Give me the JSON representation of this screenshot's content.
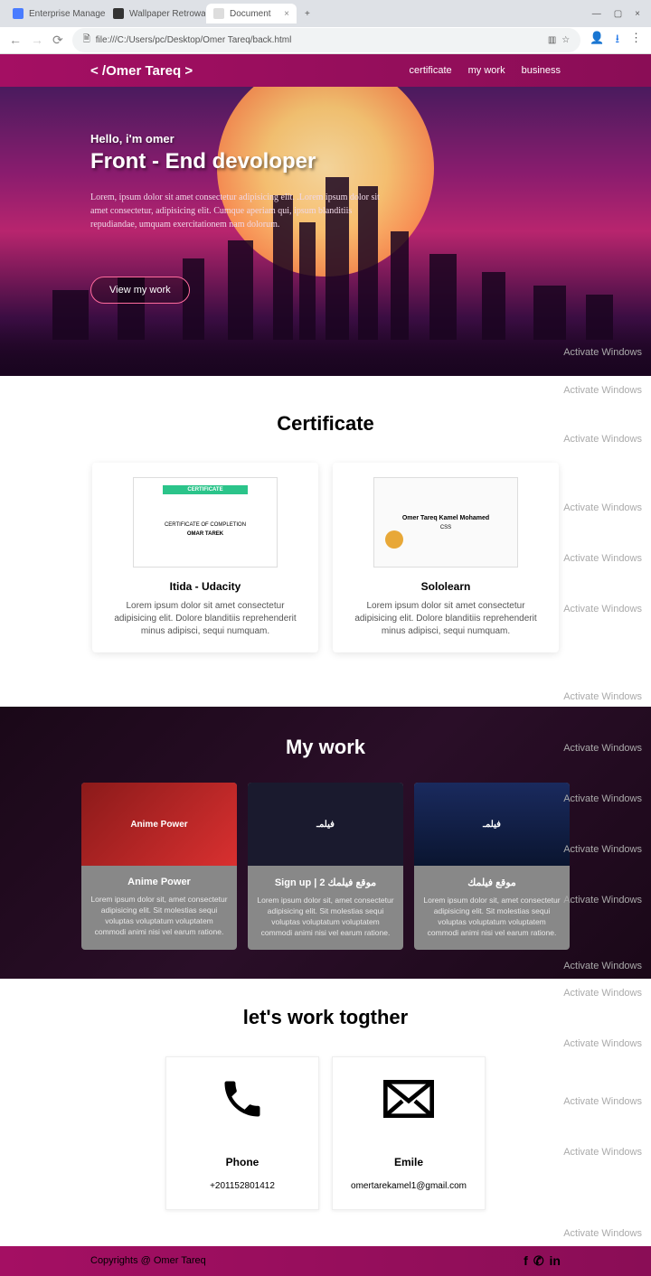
{
  "browser": {
    "tabs": [
      {
        "title": "Enterprise Management Conso"
      },
      {
        "title": "Wallpaper Retrowave, lines, su"
      },
      {
        "title": "Document"
      }
    ],
    "address": "file:///C:/Users/pc/Desktop/Omer Tareq/back.html"
  },
  "header": {
    "logo": "< /Omer Tareq >",
    "nav": [
      "certificate",
      "my work",
      "business"
    ]
  },
  "hero": {
    "greeting": "Hello, i'm omer",
    "title": "Front - End devoloper",
    "text": "Lorem, ipsum dolor sit amet consectetur adipisicing elit. .Lorem ipsum dolor sit amet consectetur, adipisicing elit. Cumque aperiam qui, ipsum blanditiis repudiandae, umquam exercitationem nam dolorum.",
    "button": "View my work"
  },
  "watermark": "Activate Windows",
  "sections": {
    "certificate": {
      "title": "Certificate",
      "cards": [
        {
          "title": "Itida - Udacity",
          "text": "Lorem ipsum dolor sit amet consectetur adipisicing elit. Dolore blanditiis reprehenderit minus adipisci, sequi numquam.",
          "inner": {
            "banner": "CERTIFICATE",
            "line1": "CERTIFICATE OF COMPLETION",
            "line2": "OMAR TAREK"
          }
        },
        {
          "title": "Sololearn",
          "text": "Lorem ipsum dolor sit amet consectetur adipisicing elit. Dolore blanditiis reprehenderit minus adipisci, sequi numquam.",
          "inner": {
            "line1": "Omer Tareq Kamel Mohamed",
            "line2": "CSS"
          }
        }
      ]
    },
    "mywork": {
      "title": "My work",
      "cards": [
        {
          "title": "Anime Power",
          "img_label": "Anime Power",
          "text": "Lorem ipsum dolor sit, amet consectetur adipisicing elit. Sit molestias sequi voluptas voluptatum voluptatem commodi animi nisi vel earum ratione."
        },
        {
          "title": "Sign up | 2 موقع فيلمك",
          "img_label": "فيلمـ",
          "text": "Lorem ipsum dolor sit, amet consectetur adipisicing elit. Sit molestias sequi voluptas voluptatum voluptatem commodi animi nisi vel earum ratione."
        },
        {
          "title": "موقع فيلمك",
          "img_label": "فيلمـ",
          "text": "Lorem ipsum dolor sit, amet consectetur adipisicing elit. Sit molestias sequi voluptas voluptatum voluptatem commodi animi nisi vel earum ratione."
        }
      ]
    },
    "contact": {
      "title": "let's work togther",
      "cards": [
        {
          "icon": "phone",
          "title": "Phone",
          "value": "+201152801412"
        },
        {
          "icon": "email",
          "title": "Emile",
          "value": "omertarekamel1@gmail.com"
        }
      ]
    }
  },
  "footer": {
    "copyright": "Copyrights @ Omer Tareq"
  }
}
